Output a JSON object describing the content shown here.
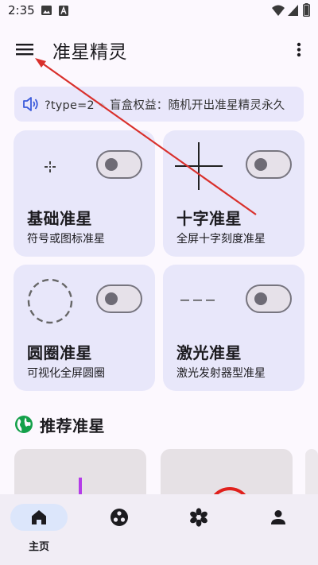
{
  "status_bar": {
    "time": "2:35",
    "icons": [
      "image-icon",
      "a-box-icon",
      "wifi-icon",
      "signal-icon",
      "battery-icon"
    ]
  },
  "app_bar": {
    "title": "准星精灵",
    "menu_icon": "hamburger-menu-icon",
    "more_icon": "more-vert-icon"
  },
  "notice": {
    "icon": "speaker-icon",
    "text_1": "?type=2",
    "text_2": "盲盒权益：随机开出准星精灵永久"
  },
  "cards": [
    {
      "title": "基础准星",
      "desc": "符号或图标准星",
      "enabled": false
    },
    {
      "title": "十字准星",
      "desc": "全屏十字刻度准星",
      "enabled": false
    },
    {
      "title": "圆圈准星",
      "desc": "可视化全屏圆圈",
      "enabled": false
    },
    {
      "title": "激光准星",
      "desc": "激光发射器型准星",
      "enabled": false
    }
  ],
  "recommend": {
    "title": "推荐准星",
    "icon": "globe-icon"
  },
  "bottom_nav": {
    "items": [
      {
        "label": "主页",
        "icon": "home-icon",
        "active": true
      },
      {
        "label": "",
        "icon": "game-icon",
        "active": false
      },
      {
        "label": "",
        "icon": "flower-icon",
        "active": false
      },
      {
        "label": "",
        "icon": "person-icon",
        "active": false
      }
    ]
  },
  "colors": {
    "background": "#fcf8fe",
    "card": "#e8e7fa",
    "notice": "#e9e7fb",
    "nav_active": "#dce6fb",
    "annotation_arrow": "#d9302c"
  }
}
